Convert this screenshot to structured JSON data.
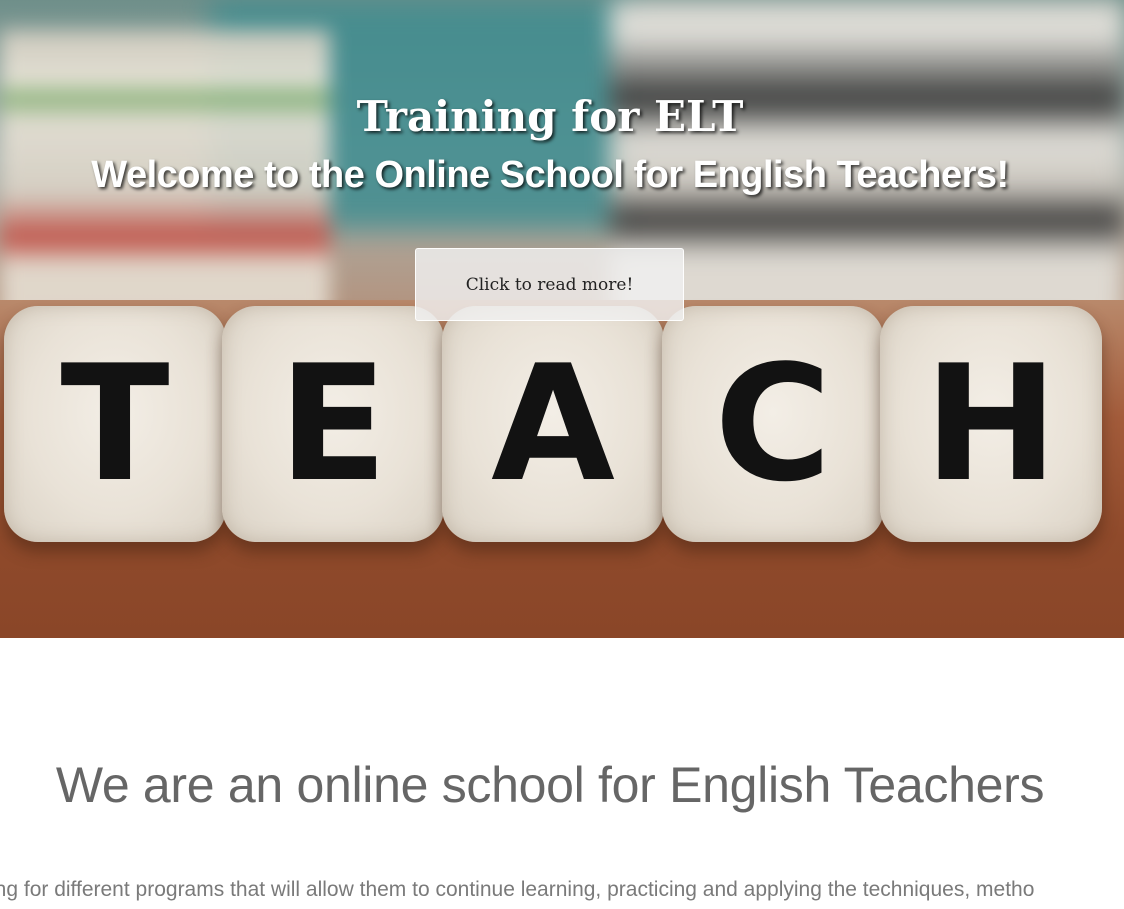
{
  "hero": {
    "title": "Training for ELT",
    "subtitle": "Welcome to the Online School for English Teachers!",
    "button_label": "Click to read more!",
    "dice_letters": [
      "T",
      "E",
      "A",
      "C",
      "H"
    ]
  },
  "intro": {
    "heading": "We are an online school for English Teachers",
    "text": "ing for different programs that will allow them to continue learning, practicing and applying the techniques, metho"
  },
  "colors": {
    "hero_text": "#ffffff",
    "heading_text": "#666666",
    "body_text": "#7a7a7a",
    "button_bg": "#f0f0f0"
  }
}
